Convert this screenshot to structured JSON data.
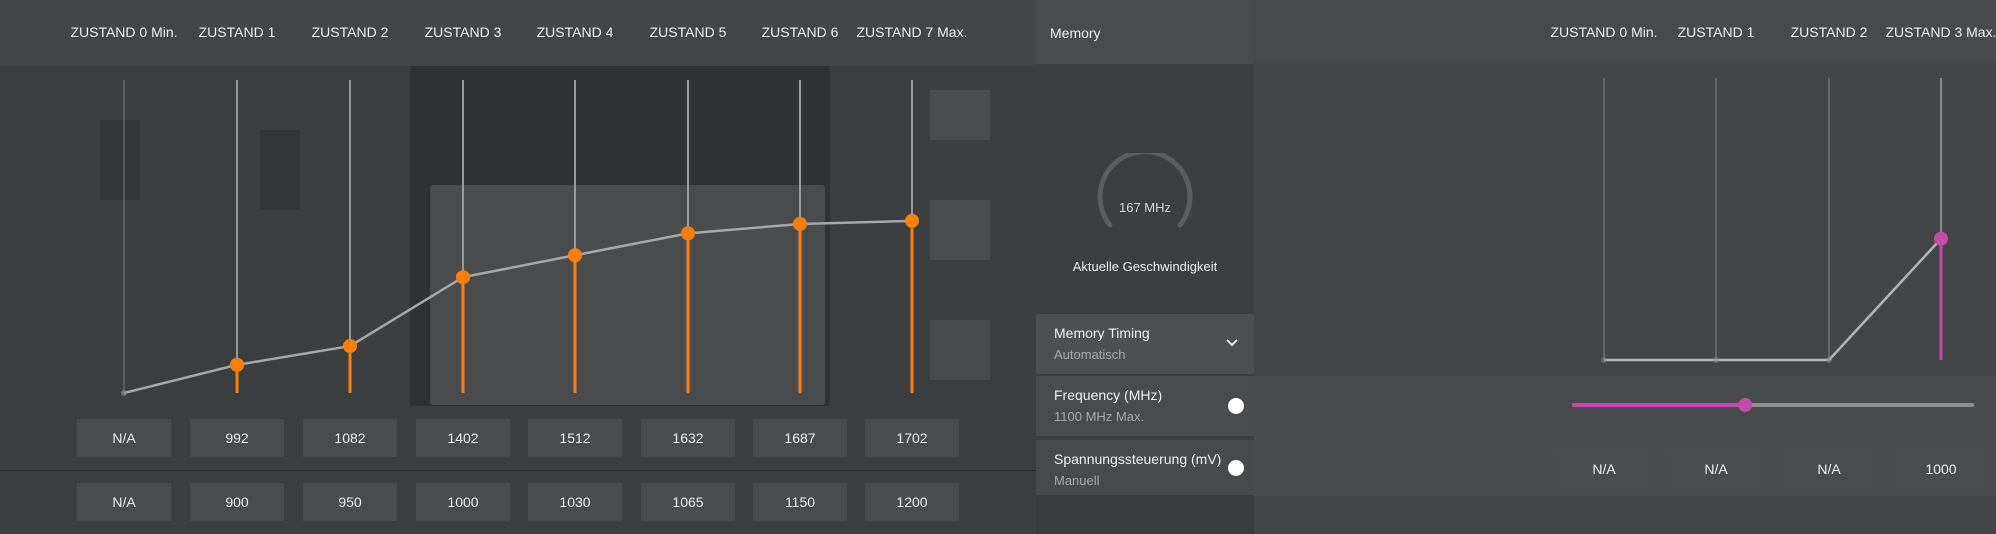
{
  "gpu_states": {
    "labels": [
      "ZUSTAND 0 Min.",
      "ZUSTAND 1",
      "ZUSTAND 2",
      "ZUSTAND 3",
      "ZUSTAND 4",
      "ZUSTAND 5",
      "ZUSTAND 6",
      "ZUSTAND 7 Max."
    ],
    "frequency_values": [
      "N/A",
      "992",
      "1082",
      "1402",
      "1512",
      "1632",
      "1687",
      "1702"
    ],
    "voltage_values": [
      "N/A",
      "900",
      "950",
      "1000",
      "1030",
      "1065",
      "1150",
      "1200"
    ],
    "point_levels": [
      0.0,
      0.09,
      0.15,
      0.37,
      0.44,
      0.51,
      0.54,
      0.55
    ],
    "active": [
      false,
      true,
      true,
      true,
      true,
      true,
      true,
      true
    ],
    "accent_color": "#ff7f0e"
  },
  "memory": {
    "header": "Memory",
    "gauge_value": "167 MHz",
    "gauge_caption": "Aktuelle Geschwindigkeit",
    "timing": {
      "title": "Memory Timing",
      "value": "Automatisch",
      "icon": "chevron-down-icon"
    },
    "frequency": {
      "title": "Frequency (MHz)",
      "value": "1100 MHz Max."
    },
    "voltage": {
      "title": "Spannungssteuerung (mV)",
      "value": "Manuell"
    }
  },
  "memory_states": {
    "labels": [
      "ZUSTAND 0 Min.",
      "ZUSTAND 1",
      "ZUSTAND 2",
      "ZUSTAND 3 Max."
    ],
    "values": [
      "N/A",
      "N/A",
      "N/A",
      "1000"
    ],
    "point_levels": [
      0.0,
      0.0,
      0.0,
      0.43
    ],
    "slider_fraction": 0.43,
    "accent_color": "#c04ca8"
  }
}
